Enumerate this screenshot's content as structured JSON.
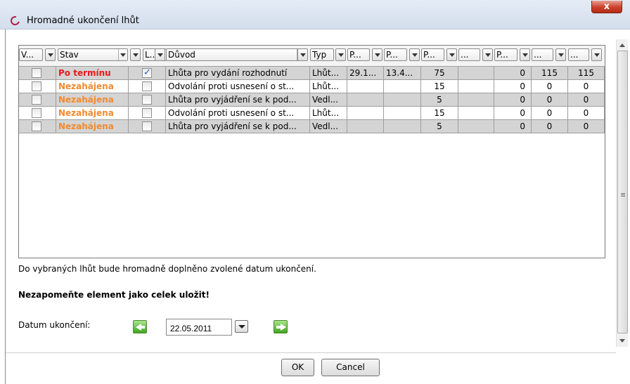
{
  "window": {
    "title": "Hromadné ukončení lhůt",
    "close_label": "x"
  },
  "table": {
    "headers": [
      "V...",
      "Stav",
      "L...",
      "Důvod",
      "Typ",
      "P...",
      "P...",
      "P...",
      "...",
      "P...",
      "...",
      "..."
    ],
    "rows": [
      {
        "checked": false,
        "stav": "Po termínu",
        "l_checked": true,
        "duvod": "Lhůta pro vydání rozhodnutí",
        "typ": "Lhůt...",
        "p1": "29.1...",
        "p2": "13.4...",
        "p3": "75",
        "c9": "",
        "p4": "0",
        "c11": "115",
        "c12": "115"
      },
      {
        "checked": false,
        "stav": "Nezahájena",
        "l_checked": false,
        "duvod": "Odvolání proti usnesení o st...",
        "typ": "Lhůt...",
        "p1": "",
        "p2": "",
        "p3": "15",
        "c9": "",
        "p4": "0",
        "c11": "0",
        "c12": "0"
      },
      {
        "checked": false,
        "stav": "Nezahájena",
        "l_checked": false,
        "duvod": "Lhůta pro vyjádření se k pod...",
        "typ": "Vedl...",
        "p1": "",
        "p2": "",
        "p3": "5",
        "c9": "",
        "p4": "0",
        "c11": "0",
        "c12": "0"
      },
      {
        "checked": false,
        "stav": "Nezahájena",
        "l_checked": false,
        "duvod": "Odvolání proti usnesení o st...",
        "typ": "Lhůt...",
        "p1": "",
        "p2": "",
        "p3": "15",
        "c9": "",
        "p4": "0",
        "c11": "0",
        "c12": "0"
      },
      {
        "checked": false,
        "stav": "Nezahájena",
        "l_checked": false,
        "duvod": "Lhůta pro vyjádření se k pod...",
        "typ": "Vedl...",
        "p1": "",
        "p2": "",
        "p3": "5",
        "c9": "",
        "p4": "0",
        "c11": "0",
        "c12": "0"
      }
    ]
  },
  "info_text": "Do vybraných lhůt bude hromadně doplněno zvolené datum ukončení.",
  "warning_text": "Nezapomeňte element jako celek uložit!",
  "date": {
    "label": "Datum ukončení:",
    "value": "22.05.2011"
  },
  "buttons": {
    "ok": "OK",
    "cancel": "Cancel"
  },
  "colors": {
    "status_overdue": "#e81919",
    "status_not_started": "#f18a2e",
    "close_button": "#c9402b"
  }
}
